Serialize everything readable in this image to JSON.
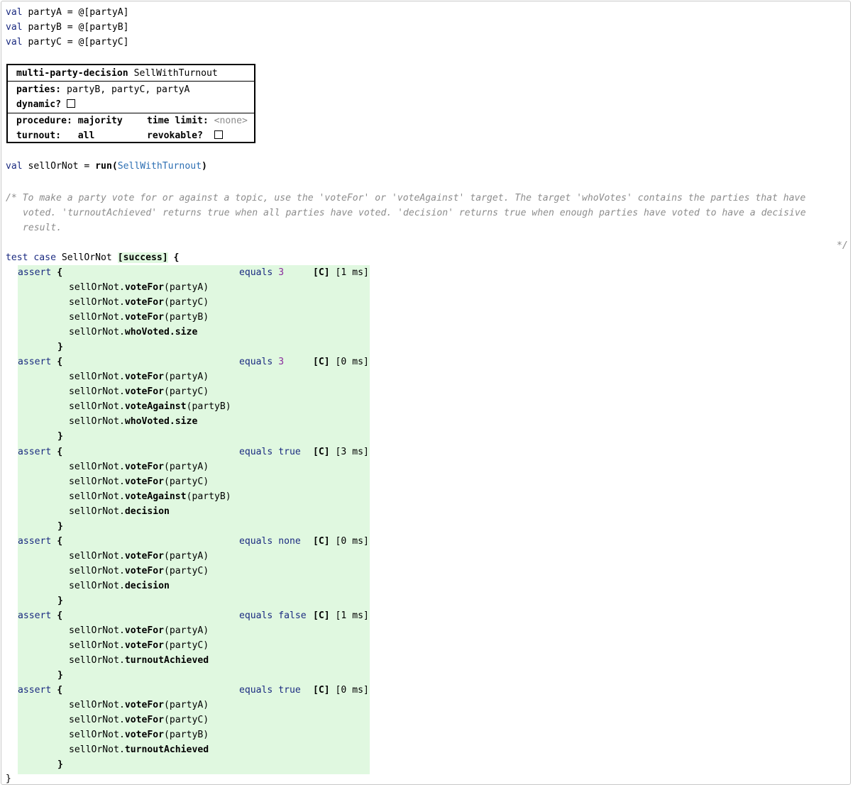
{
  "vals": [
    {
      "keyword": "val",
      "name": "partyA",
      "op": "=",
      "value": "@[partyA]"
    },
    {
      "keyword": "val",
      "name": "partyB",
      "op": "=",
      "value": "@[partyB]"
    },
    {
      "keyword": "val",
      "name": "partyC",
      "op": "=",
      "value": "@[partyC]"
    }
  ],
  "decision": {
    "keyword": "multi-party-decision",
    "name": "SellWithTurnout",
    "parties_label": "parties:",
    "parties": "partyB, partyC, partyA",
    "dynamic_label": "dynamic?",
    "dynamic_checked": false,
    "procedure_label": "procedure:",
    "procedure": "majority",
    "time_limit_label": "time limit:",
    "time_limit": "<none>",
    "turnout_label": "turnout:",
    "turnout": "all",
    "revokable_label": "revokable?",
    "revokable_checked": false
  },
  "run_line": {
    "keyword": "val",
    "name": "sellOrNot",
    "op": "=",
    "fn": "run(",
    "arg": "SellWithTurnout",
    "close": ")"
  },
  "comment": {
    "open": "/*",
    "line1": " To make a party vote for or against a topic, use the 'voteFor' or 'voteAgainst' target. The target 'whoVotes' contains the parties that have",
    "line2": "voted. 'turnoutAchieved' returns true when all parties have voted. 'decision' returns true when enough parties have voted to have a decisive",
    "line3": "result.",
    "close": "*/"
  },
  "test_case": {
    "keyword": "test case",
    "name": "SellOrNot",
    "status": "[success]",
    "open": "{",
    "close": "}",
    "asserts": [
      {
        "keyword": "assert",
        "open": "{",
        "close": "}",
        "equals_kw": "equals",
        "expected": "3",
        "expected_kind": "num",
        "marker": "[C]",
        "time": "[1 ms]",
        "lines": [
          {
            "obj": "sellOrNot.",
            "member": "voteFor",
            "args": "(partyA)"
          },
          {
            "obj": "sellOrNot.",
            "member": "voteFor",
            "args": "(partyC)"
          },
          {
            "obj": "sellOrNot.",
            "member": "voteFor",
            "args": "(partyB)"
          },
          {
            "obj": "sellOrNot.",
            "member": "whoVoted.size",
            "args": ""
          }
        ]
      },
      {
        "keyword": "assert",
        "open": "{",
        "close": "}",
        "equals_kw": "equals",
        "expected": "3",
        "expected_kind": "num",
        "marker": "[C]",
        "time": "[0 ms]",
        "lines": [
          {
            "obj": "sellOrNot.",
            "member": "voteFor",
            "args": "(partyA)"
          },
          {
            "obj": "sellOrNot.",
            "member": "voteFor",
            "args": "(partyC)"
          },
          {
            "obj": "sellOrNot.",
            "member": "voteAgainst",
            "args": "(partyB)"
          },
          {
            "obj": "sellOrNot.",
            "member": "whoVoted.size",
            "args": ""
          }
        ]
      },
      {
        "keyword": "assert",
        "open": "{",
        "close": "}",
        "equals_kw": "equals",
        "expected": "true",
        "expected_kind": "kw",
        "marker": "[C]",
        "time": "[3 ms]",
        "lines": [
          {
            "obj": "sellOrNot.",
            "member": "voteFor",
            "args": "(partyA)"
          },
          {
            "obj": "sellOrNot.",
            "member": "voteFor",
            "args": "(partyC)"
          },
          {
            "obj": "sellOrNot.",
            "member": "voteAgainst",
            "args": "(partyB)"
          },
          {
            "obj": "sellOrNot.",
            "member": "decision",
            "args": ""
          }
        ]
      },
      {
        "keyword": "assert",
        "open": "{",
        "close": "}",
        "equals_kw": "equals",
        "expected": "none",
        "expected_kind": "kw",
        "marker": "[C]",
        "time": "[0 ms]",
        "lines": [
          {
            "obj": "sellOrNot.",
            "member": "voteFor",
            "args": "(partyA)"
          },
          {
            "obj": "sellOrNot.",
            "member": "voteFor",
            "args": "(partyC)"
          },
          {
            "obj": "sellOrNot.",
            "member": "decision",
            "args": ""
          }
        ]
      },
      {
        "keyword": "assert",
        "open": "{",
        "close": "}",
        "equals_kw": "equals",
        "expected": "false",
        "expected_kind": "kw",
        "marker": "[C]",
        "time": "[1 ms]",
        "lines": [
          {
            "obj": "sellOrNot.",
            "member": "voteFor",
            "args": "(partyA)"
          },
          {
            "obj": "sellOrNot.",
            "member": "voteFor",
            "args": "(partyC)"
          },
          {
            "obj": "sellOrNot.",
            "member": "turnoutAchieved",
            "args": ""
          }
        ]
      },
      {
        "keyword": "assert",
        "open": "{",
        "close": "}",
        "equals_kw": "equals",
        "expected": "true",
        "expected_kind": "kw",
        "marker": "[C]",
        "time": "[0 ms]",
        "lines": [
          {
            "obj": "sellOrNot.",
            "member": "voteFor",
            "args": "(partyA)"
          },
          {
            "obj": "sellOrNot.",
            "member": "voteFor",
            "args": "(partyC)"
          },
          {
            "obj": "sellOrNot.",
            "member": "voteFor",
            "args": "(partyB)"
          },
          {
            "obj": "sellOrNot.",
            "member": "turnoutAchieved",
            "args": ""
          }
        ]
      }
    ]
  }
}
